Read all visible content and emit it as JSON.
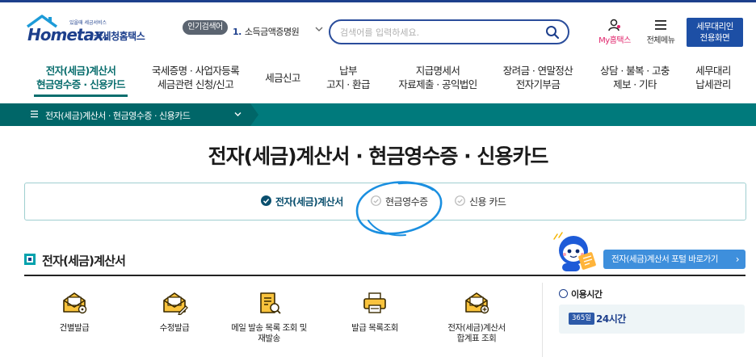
{
  "header": {
    "logo_sub": "있을때 세금서비스",
    "logo_main": "Hometax.",
    "logo_kr": "국세청홈택스",
    "popular_badge": "인기검색어",
    "popular_rank": "1.",
    "popular_term": "소득금액증명원",
    "search_placeholder": "검색어를 입력하세요.",
    "my_hometax": "My홈택스",
    "all_menu": "전체메뉴",
    "agent_line1": "세무대리인",
    "agent_line2": "전용화면"
  },
  "nav": [
    {
      "line1": "전자(세금)계산서",
      "line2": "현금영수증 · 신용카드"
    },
    {
      "line1": "국세증명 · 사업자등록",
      "line2": "세금관련 신청/신고"
    },
    {
      "line1": "세금신고",
      "line2": ""
    },
    {
      "line1": "납부",
      "line2": "고지 · 환급"
    },
    {
      "line1": "지급명세서",
      "line2": "자료제출 · 공익법인"
    },
    {
      "line1": "장려금 · 연말정산",
      "line2": "전자기부금"
    },
    {
      "line1": "상담 · 불복 · 고충",
      "line2": "제보 · 기타"
    },
    {
      "line1": "세무대리",
      "line2": "납세관리"
    }
  ],
  "breadcrumb": "전자(세금)계산서 · 현금영수증 · 신용카드",
  "page_title": "전자(세금)계산서 · 현금영수증 · 신용카드",
  "tabs": [
    {
      "label": "전자(세금)계산서",
      "active": true
    },
    {
      "label": "현금영수증",
      "active": false
    },
    {
      "label": "신용 카드",
      "active": false
    }
  ],
  "section": {
    "title": "전자(세금)계산서",
    "portal_button": "전자(세금)계산서 포털 바로가기",
    "portal_arrow": "›"
  },
  "menu_items": [
    {
      "label_line1": "건별발급",
      "label_line2": ""
    },
    {
      "label_line1": "수정발급",
      "label_line2": ""
    },
    {
      "label_line1": "메일 발송 목록 조회 및",
      "label_line2": "재발송"
    },
    {
      "label_line1": "발급 목록조회",
      "label_line2": ""
    },
    {
      "label_line1": "전자(세금)계산서",
      "label_line2": "합계표 조회"
    }
  ],
  "hours": {
    "title": "이용시간",
    "badge": "365일",
    "value": "24시간"
  },
  "colors": {
    "brand_navy": "#1d3f8c",
    "teal": "#007a7c",
    "annotation_blue": "#1a8fe0",
    "portal_blue": "#3e8fdc"
  }
}
